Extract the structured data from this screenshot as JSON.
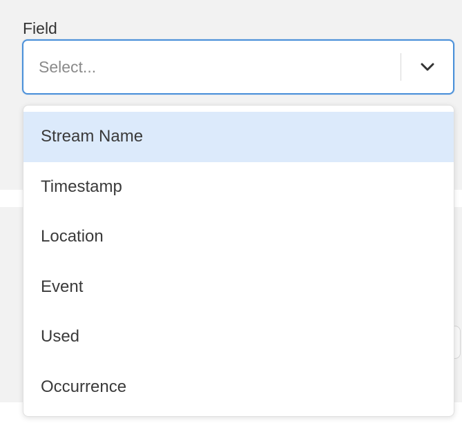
{
  "field": {
    "label": "Field",
    "placeholder": "Select..."
  },
  "dropdown": {
    "options": [
      {
        "label": "Stream Name",
        "highlighted": true
      },
      {
        "label": "Timestamp",
        "highlighted": false
      },
      {
        "label": "Location",
        "highlighted": false
      },
      {
        "label": "Event",
        "highlighted": false
      },
      {
        "label": "Used",
        "highlighted": false
      },
      {
        "label": "Occurrence",
        "highlighted": false
      }
    ]
  },
  "colors": {
    "focus_border": "#4a90d9",
    "highlight": "#dceafb",
    "background_panel": "#f2f2f2"
  },
  "icons": {
    "dropdown_indicator": "chevron-down-icon"
  }
}
